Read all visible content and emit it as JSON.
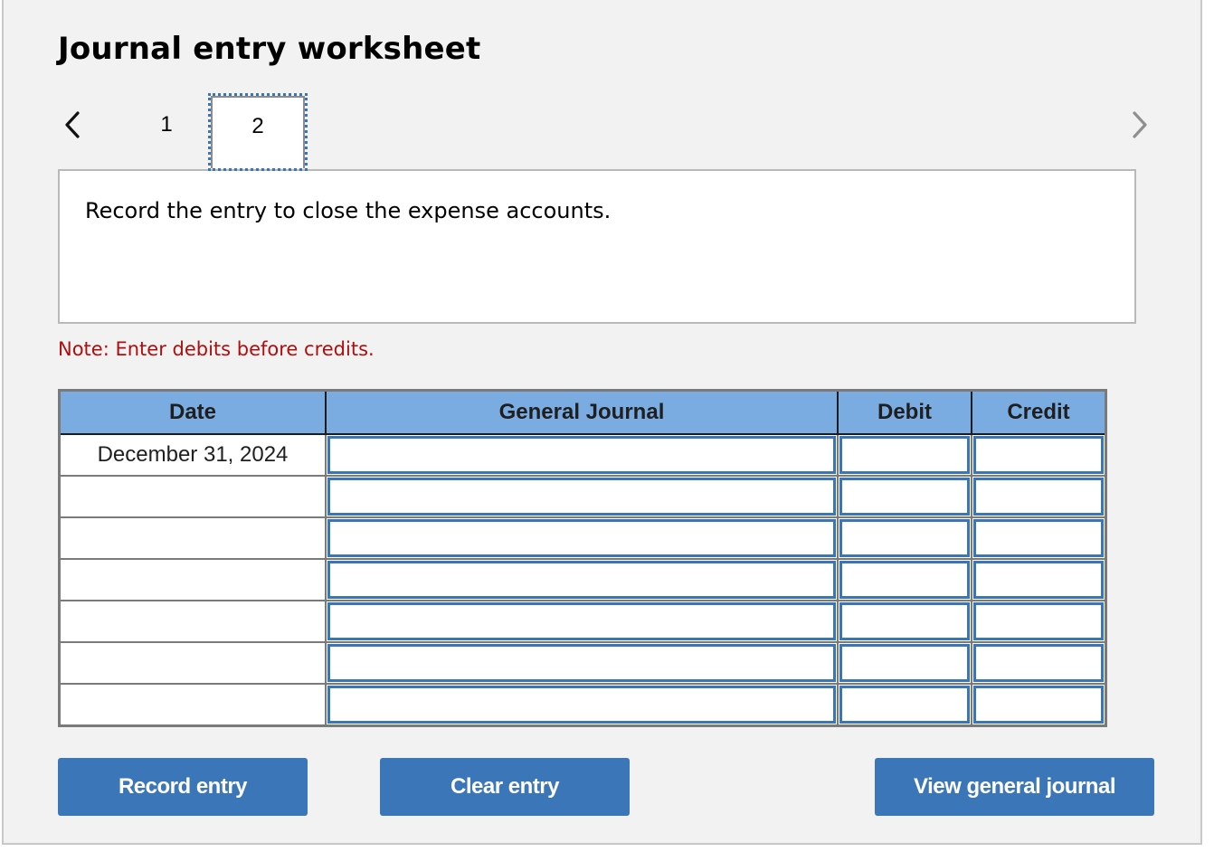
{
  "header": {
    "title": "Journal entry worksheet"
  },
  "pager": {
    "prev_icon": "chevron-left-icon",
    "next_icon": "chevron-right-icon",
    "tabs": [
      {
        "label": "1",
        "active": false
      },
      {
        "label": "2",
        "active": true
      }
    ]
  },
  "prompt": {
    "text": "Record the entry to close the expense accounts."
  },
  "note": {
    "text": "Note: Enter debits before credits."
  },
  "table": {
    "headers": {
      "date": "Date",
      "journal": "General Journal",
      "debit": "Debit",
      "credit": "Credit"
    },
    "rows": [
      {
        "date": "December 31, 2024",
        "journal": "",
        "debit": "",
        "credit": ""
      },
      {
        "date": "",
        "journal": "",
        "debit": "",
        "credit": ""
      },
      {
        "date": "",
        "journal": "",
        "debit": "",
        "credit": ""
      },
      {
        "date": "",
        "journal": "",
        "debit": "",
        "credit": ""
      },
      {
        "date": "",
        "journal": "",
        "debit": "",
        "credit": ""
      },
      {
        "date": "",
        "journal": "",
        "debit": "",
        "credit": ""
      },
      {
        "date": "",
        "journal": "",
        "debit": "",
        "credit": ""
      }
    ]
  },
  "buttons": {
    "record": "Record entry",
    "clear": "Clear entry",
    "view": "View general journal"
  },
  "colors": {
    "header_bg": "#7aace2",
    "button_bg": "#3b76b9",
    "input_border": "#3a75b8",
    "note_text": "#b00e0e",
    "panel_bg": "#f2f2f2"
  }
}
